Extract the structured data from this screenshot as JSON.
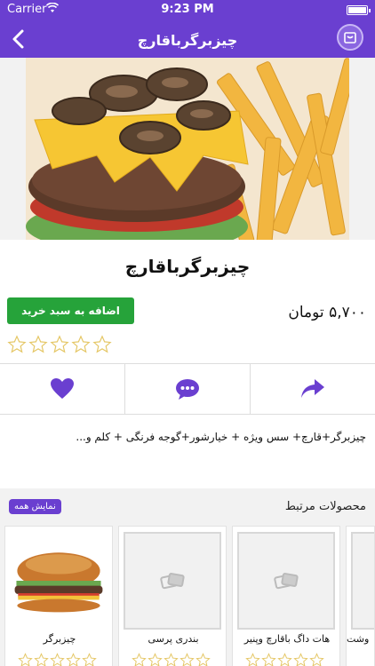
{
  "status": {
    "carrier": "Carrier",
    "time": "9:23 PM"
  },
  "nav": {
    "title": "چیزبرگرباقارچ"
  },
  "product": {
    "title": "چیزبرگرباقارچ",
    "price": "۵,۷۰۰  تومان",
    "add_to_cart": "اضافه به سبد خرید",
    "rating": 0,
    "rating_max": 5,
    "description": "چیزبرگر+قارچ+ سس ویژه + خیارشور+گوجه فرنگی + کلم و..."
  },
  "related": {
    "heading": "محصولات مرتبط",
    "show_all": "نمایش همه",
    "items": [
      {
        "name": "چیزبرگر"
      },
      {
        "name": "بندری پرسی"
      },
      {
        "name": "هات داگ باقارچ وپنیر"
      },
      {
        "name": "وشت"
      }
    ]
  },
  "colors": {
    "brand": "#6a3fd0",
    "add_button": "#26a33a",
    "star": "#e5c766"
  },
  "icons": [
    "back-chevron-icon",
    "cart-icon",
    "share-icon",
    "comment-icon",
    "heart-icon",
    "image-placeholder-icon"
  ]
}
